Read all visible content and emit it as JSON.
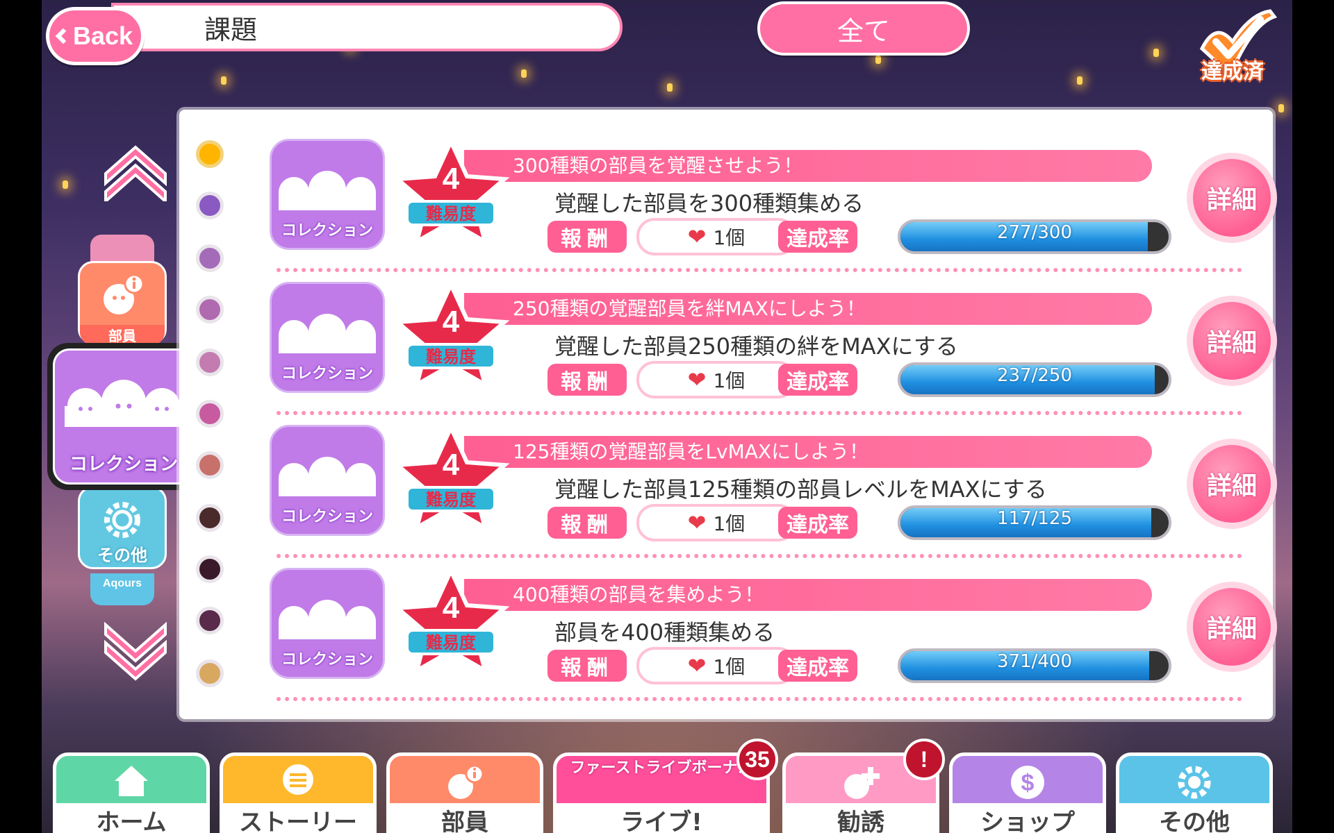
{
  "header": {
    "back_label": "Back",
    "title": "課題",
    "filter_label": "全て",
    "achieved_label": "達成済"
  },
  "side_nav": {
    "member_label": "部員",
    "collection_label": "コレクション",
    "other_label": "その他",
    "aqours_label": "Aqours"
  },
  "labels": {
    "reward": "報酬",
    "achievement_rate": "達成率",
    "detail": "詳細",
    "difficulty": "難易度",
    "category": "コレクション"
  },
  "goals": [
    {
      "title": "300種類の部員を覚醒させよう！",
      "description": "覚醒した部員を300種類集める",
      "difficulty": "4",
      "reward": "1個",
      "progress_text": "277/300",
      "progress": 0.923
    },
    {
      "title": "250種類の覚醒部員を絆MAXにしよう！",
      "description": "覚醒した部員250種類の絆をMAXにする",
      "difficulty": "4",
      "reward": "1個",
      "progress_text": "237/250",
      "progress": 0.948
    },
    {
      "title": "125種類の覚醒部員をLvMAXにしよう！",
      "description": "覚醒した部員125種類の部員レベルをMAXにする",
      "difficulty": "4",
      "reward": "1個",
      "progress_text": "117/125",
      "progress": 0.936
    },
    {
      "title": "400種類の部員を集めよう！",
      "description": "部員を400種類集める",
      "difficulty": "4",
      "reward": "1個",
      "progress_text": "371/400",
      "progress": 0.9275
    }
  ],
  "bottom_nav": {
    "home": "ホーム",
    "story": "ストーリー",
    "member": "部員",
    "live_banner": "ファーストライブボーナス",
    "live": "ライブ!",
    "live_badge": "35",
    "scout": "勧誘",
    "shop": "ショップ",
    "other": "その他"
  },
  "colors": {
    "accent_pink": "#ff5f93",
    "collection_purple": "#c07be8",
    "progress_blue": "#1f8fe0"
  }
}
